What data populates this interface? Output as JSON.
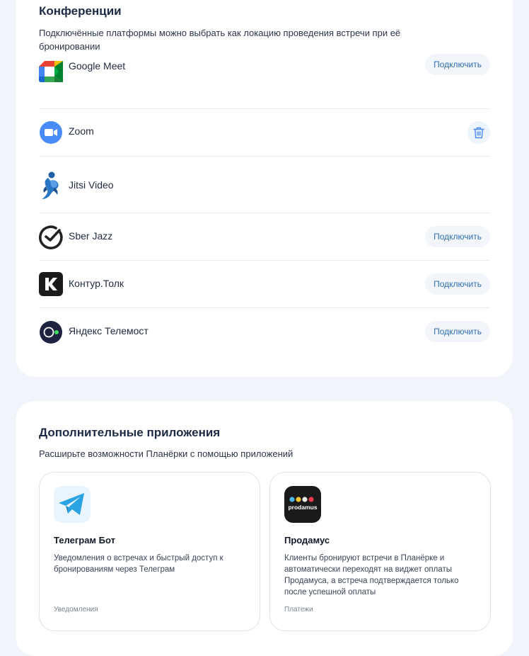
{
  "conferences": {
    "title": "Конференции",
    "description": "Подключённые платформы можно выбрать как локацию проведения встречи при её бронировании",
    "items": [
      {
        "name": "Google Meet",
        "action": "Подключить",
        "icon": "google-meet-icon"
      },
      {
        "name": "Zoom",
        "action": "",
        "icon": "zoom-icon"
      },
      {
        "name": "Jitsi Video",
        "action": "",
        "icon": "jitsi-icon"
      },
      {
        "name": "Sber Jazz",
        "action": "Подключить",
        "icon": "sber-jazz-icon"
      },
      {
        "name": "Контур.Толк",
        "action": "Подключить",
        "icon": "kontur-tolk-icon"
      },
      {
        "name": "Яндекс Телемост",
        "action": "Подключить",
        "icon": "yandex-telemost-icon"
      }
    ],
    "zoom_delete_icon": "trash-icon"
  },
  "apps": {
    "title": "Дополнительные приложения",
    "description": "Расширьте возможности Планёрки с помощью приложений",
    "items": [
      {
        "name": "Телеграм Бот",
        "description": "Уведомления о встречах и быстрый доступ к бронированиям через Телеграм",
        "tag": "Уведомления",
        "icon": "telegram-icon"
      },
      {
        "name": "Продамус",
        "description": "Клиенты бронируют встречи в Планёрке и автоматически переходят на виджет оплаты Продамуса, а встреча подтверждается только после успешной оплаты",
        "tag": "Платежи",
        "icon": "prodamus-icon",
        "logo_text": "prodamus"
      }
    ]
  },
  "colors": {
    "page_bg": "#f1f4fb",
    "accent": "#2f6fb2",
    "button_bg": "#f2f6fb"
  }
}
